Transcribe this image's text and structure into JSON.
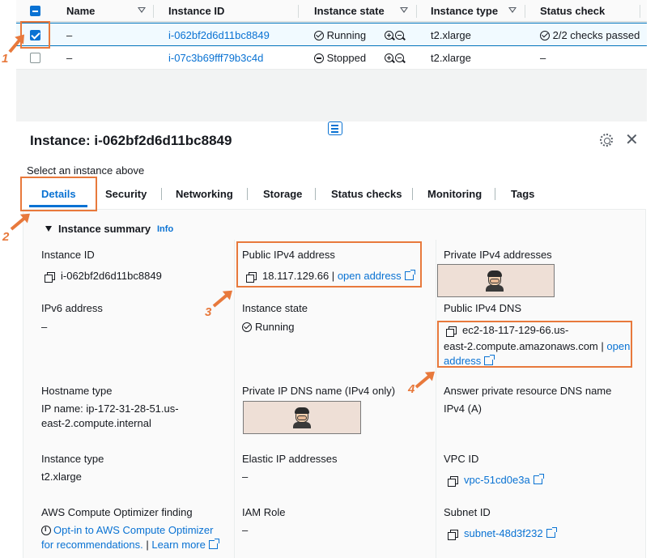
{
  "table": {
    "columns": [
      "Name",
      "Instance ID",
      "Instance state",
      "Instance type",
      "Status check"
    ],
    "rows": [
      {
        "name": "–",
        "id": "i-062bf2d6d11bc8849",
        "state": "Running",
        "type": "t2.xlarge",
        "status": "2/2 checks passed",
        "selected": true
      },
      {
        "name": "–",
        "id": "i-07c3b69fff79b3c4d",
        "state": "Stopped",
        "type": "t2.xlarge",
        "status": "–",
        "selected": false
      }
    ]
  },
  "panel": {
    "title": "Instance: i-062bf2d6d11bc8849",
    "hint": "Select an instance above",
    "tabs": [
      "Details",
      "Security",
      "Networking",
      "Storage",
      "Status checks",
      "Monitoring",
      "Tags"
    ],
    "active_tab": "Details",
    "summary_title": "Instance summary",
    "info_link": "Info"
  },
  "fields": {
    "instance_id": {
      "label": "Instance ID",
      "value": "i-062bf2d6d11bc8849"
    },
    "public_ipv4": {
      "label": "Public IPv4 address",
      "value": "18.117.129.66",
      "sep": "|",
      "link": "open address"
    },
    "private_ipv4": {
      "label": "Private IPv4 addresses"
    },
    "ipv6": {
      "label": "IPv6 address",
      "value": "–"
    },
    "state": {
      "label": "Instance state",
      "value": "Running"
    },
    "public_dns": {
      "label": "Public IPv4 DNS",
      "line1": "ec2-18-117-129-66.us-",
      "line2": "east-2.compute.amazonaws.com",
      "sep": "|",
      "link1": "open",
      "link2": "address"
    },
    "hostname_type": {
      "label": "Hostname type",
      "line1": "IP name: ip-172-31-28-51.us-",
      "line2": "east-2.compute.internal"
    },
    "private_dns": {
      "label": "Private IP DNS name (IPv4 only)"
    },
    "answer_dns": {
      "label": "Answer private resource DNS name",
      "value": "IPv4 (A)"
    },
    "instance_type": {
      "label": "Instance type",
      "value": "t2.xlarge"
    },
    "elastic_ip": {
      "label": "Elastic IP addresses",
      "value": "–"
    },
    "vpc": {
      "label": "VPC ID",
      "value": "vpc-51cd0e3a"
    },
    "optimizer": {
      "label": "AWS Compute Optimizer finding",
      "line1": "Opt-in to AWS Compute Optimizer",
      "line2": "for recommendations.",
      "sep": "|",
      "link": "Learn more"
    },
    "iam": {
      "label": "IAM Role",
      "value": "–"
    },
    "subnet": {
      "label": "Subnet ID",
      "value": "subnet-48d3f232"
    }
  },
  "annotations": [
    "1",
    "2",
    "3",
    "4"
  ],
  "colors": {
    "accent": "#0972d3",
    "annotation": "#e8793c",
    "selected_row": "#f1faff"
  }
}
